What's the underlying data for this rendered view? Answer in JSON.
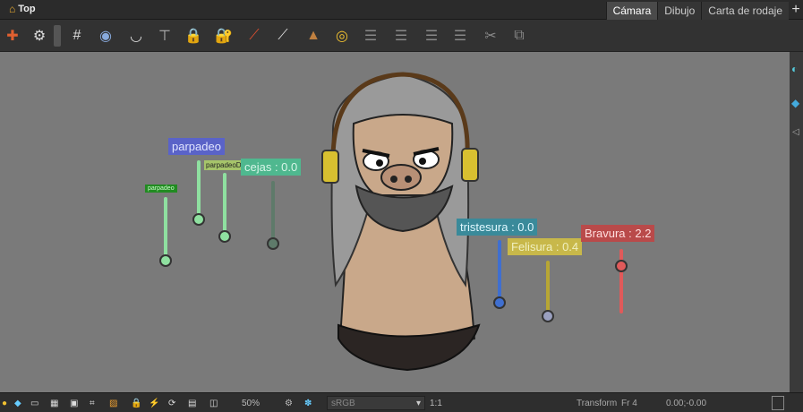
{
  "titlebar": {
    "title": "Top",
    "tabs": [
      "Cámara",
      "Dibujo",
      "Carta de rodaje"
    ],
    "plus": "+"
  },
  "sliders": {
    "parpadeo": "parpadeo",
    "parpadeo_small": "parpadeo",
    "parpadeo2": "parpadeoDer",
    "cejas": "cejas : 0.0",
    "tristesura": "tristesura : 0.0",
    "felisura": "Felisura : 0.4",
    "bravura": "Bravura : 2.2"
  },
  "statusbar": {
    "zoom": "50%",
    "colorspace": "sRGB",
    "ratio": "1:1",
    "mode": "Transform",
    "frame": "Fr 4",
    "coords": "0.00;-0.00"
  },
  "colors": {
    "accent": "#4a4a4a",
    "bravura": "#e05a5a",
    "felisura": "#b7a634",
    "tristesura": "#3f6fd0",
    "cejas": "#3fb58a"
  }
}
